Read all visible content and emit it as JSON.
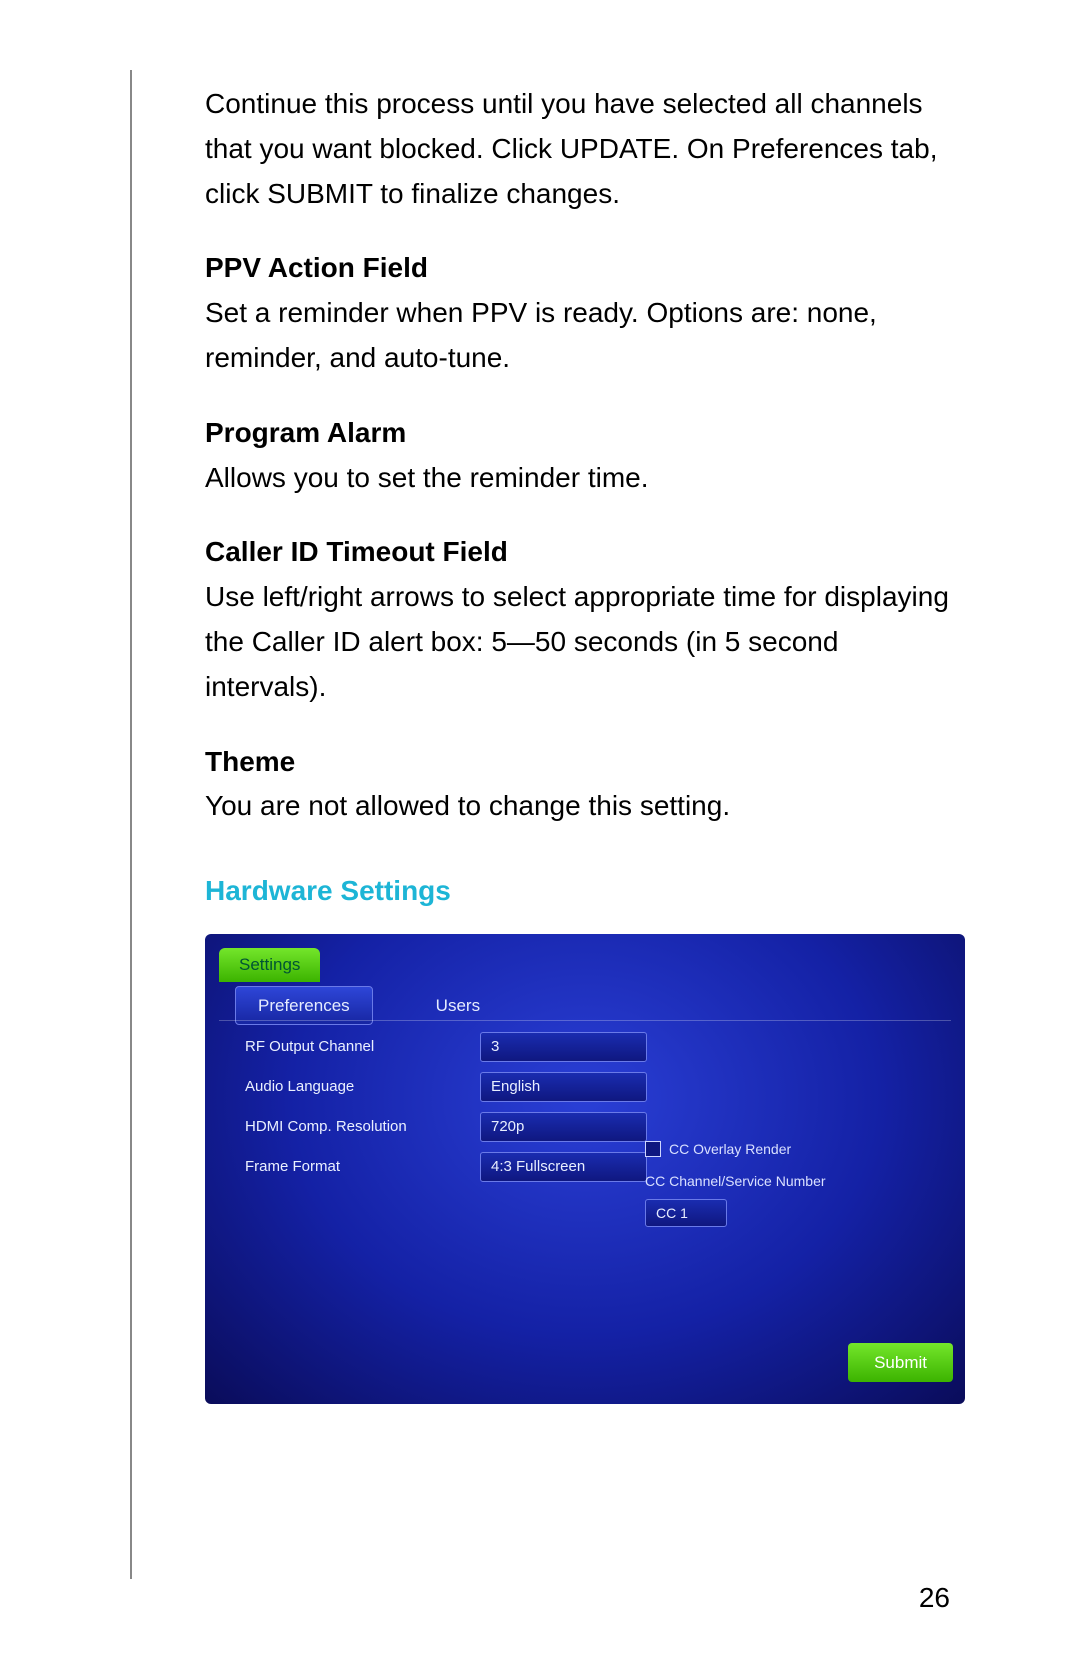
{
  "intro": "Continue this process until you have selected all channels that you want blocked. Click UPDATE. On Preferences tab, click SUBMIT to finalize changes.",
  "sections": [
    {
      "h": "PPV Action Field",
      "body": "Set a reminder when PPV is ready. Options are: none, reminder, and auto-tune."
    },
    {
      "h": "Program Alarm",
      "body": "Allows you to set the reminder time."
    },
    {
      "h": "Caller ID Timeout Field",
      "body": "Use left/right arrows to select appropriate time for displaying the Caller ID alert box: 5—50 seconds (in 5 second intervals)."
    },
    {
      "h": "Theme",
      "body": "You are not allowed to change this setting."
    }
  ],
  "hw_title": "Hardware Settings",
  "tv": {
    "title_tab": "Settings",
    "tabs": {
      "preferences": "Preferences",
      "users": "Users"
    },
    "rows": [
      {
        "label": "RF Output Channel",
        "value": "3"
      },
      {
        "label": "Audio Language",
        "value": "English"
      },
      {
        "label": "HDMI Comp. Resolution",
        "value": "720p"
      },
      {
        "label": "Frame Format",
        "value": "4:3 Fullscreen"
      }
    ],
    "cc_overlay_label": "CC Overlay Render",
    "cc_channel_label": "CC Channel/Service Number",
    "cc_channel_value": "CC 1",
    "submit": "Submit"
  },
  "pagenum": "26"
}
